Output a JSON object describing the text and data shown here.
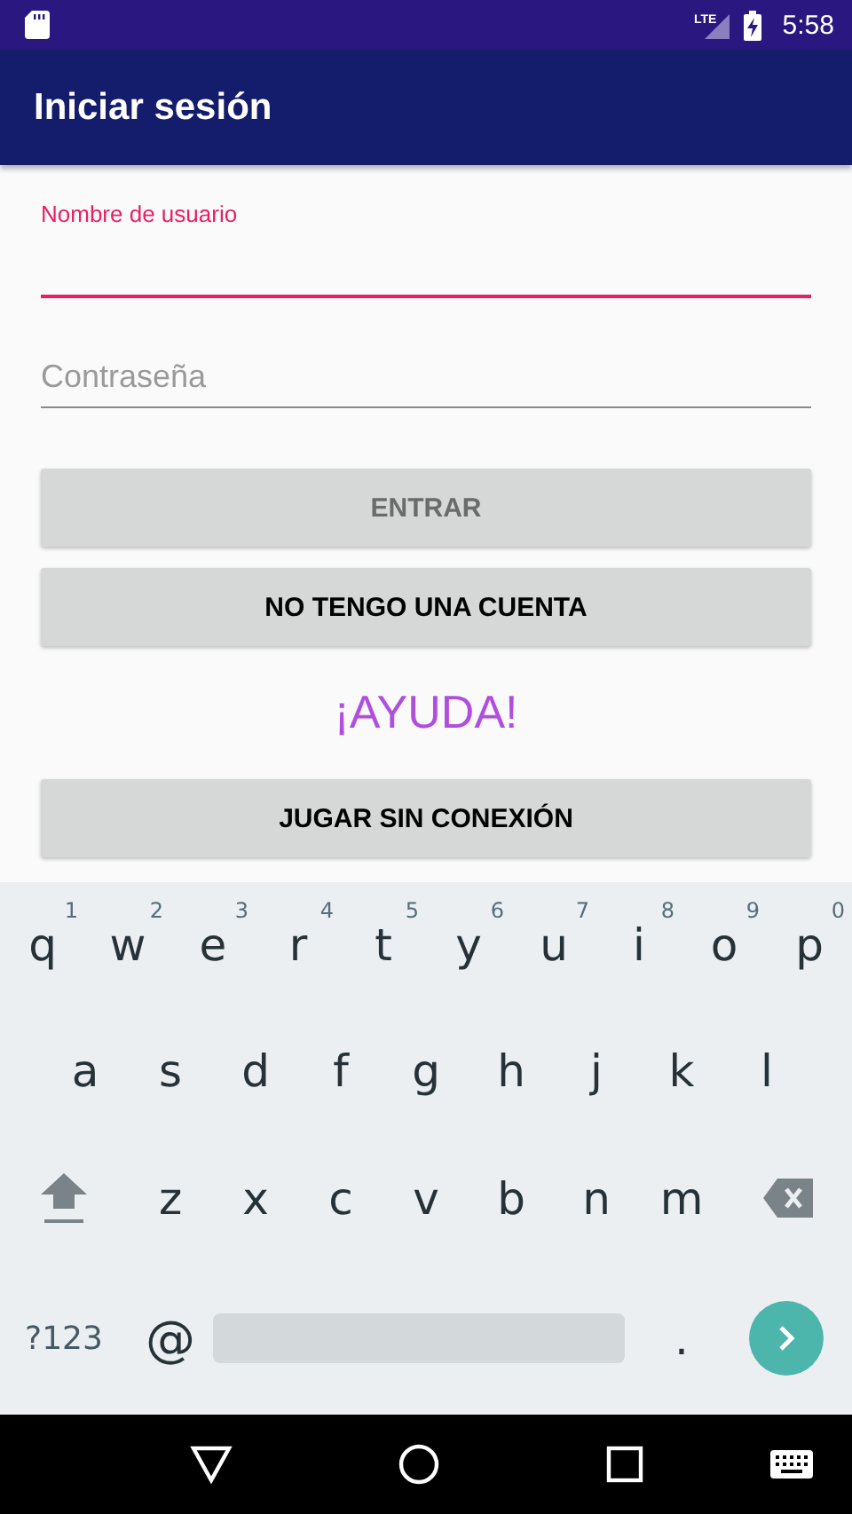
{
  "status_bar": {
    "network": "LTE",
    "time": "5:58"
  },
  "app_bar": {
    "title": "Iniciar sesión"
  },
  "fields": [
    {
      "kind": "text",
      "label": "Nombre de usuario",
      "focused": true
    },
    {
      "kind": "password",
      "placeholder": "Contraseña",
      "focused": false
    }
  ],
  "buttons": [
    {
      "kind": "button",
      "label": "ENTRAR",
      "disabled": true
    },
    {
      "kind": "button",
      "label": "NO TENGO UNA CUENTA",
      "disabled": false
    },
    {
      "kind": "link",
      "label": "¡AYUDA!",
      "disabled": false
    },
    {
      "kind": "button",
      "label": "JUGAR SIN CONEXIÓN",
      "disabled": false
    }
  ],
  "keyboard": {
    "row_1": [
      {
        "label": "q",
        "hint": "1"
      },
      {
        "label": "w",
        "hint": "2"
      },
      {
        "label": "e",
        "hint": "3"
      },
      {
        "label": "r",
        "hint": "4"
      },
      {
        "label": "t",
        "hint": "5"
      },
      {
        "label": "y",
        "hint": "6"
      },
      {
        "label": "u",
        "hint": "7"
      },
      {
        "label": "i",
        "hint": "8"
      },
      {
        "label": "o",
        "hint": "9"
      },
      {
        "label": "p",
        "hint": "0"
      }
    ],
    "row_2": [
      "a",
      "s",
      "d",
      "f",
      "g",
      "h",
      "j",
      "k",
      "l"
    ],
    "row_3": [
      "z",
      "x",
      "c",
      "v",
      "b",
      "n",
      "m"
    ],
    "symbols_key": "?123",
    "at_key": "@",
    "period_key": "."
  }
}
